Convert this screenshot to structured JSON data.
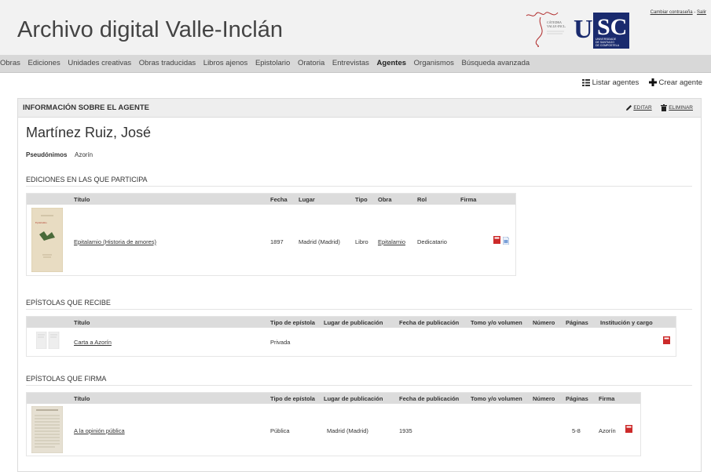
{
  "header": {
    "title": "Archivo digital Valle-Inclán",
    "logo_catedra_text": [
      "CÁTEDRA",
      "VALLE-INCLÁN"
    ],
    "logo_usc": {
      "letters": "USC",
      "lines": [
        "UNIVERSIDADE",
        "DE SANTIAGO",
        "DE COMPOSTELA"
      ]
    },
    "change_password": "Cambiar contraseña",
    "separator": "-",
    "logout": "Salir"
  },
  "nav": {
    "items": [
      "Obras",
      "Ediciones",
      "Unidades creativas",
      "Obras traducidas",
      "Libros ajenos",
      "Epistolario",
      "Oratoria",
      "Entrevistas",
      "Agentes",
      "Organismos",
      "Búsqueda avanzada"
    ],
    "active": "Agentes"
  },
  "actions": {
    "list": "Listar agentes",
    "create": "Crear agente"
  },
  "panel": {
    "title": "INFORMACIÓN SOBRE EL AGENTE",
    "edit": "EDITAR",
    "delete": "ELIMINAR"
  },
  "agent": {
    "name": "Martínez Ruiz, José",
    "pseudonyms_label": "Pseudónimos",
    "pseudonyms": "Azorín"
  },
  "editions": {
    "title": "EDICIONES EN LAS QUE PARTICIPA",
    "headers": [
      "Título",
      "Fecha",
      "Lugar",
      "Tipo",
      "Obra",
      "Rol",
      "Firma"
    ],
    "rows": [
      {
        "title": "Epitalamio (Historia de amores)",
        "date": "1897",
        "place": "Madrid (Madrid)",
        "type": "Libro",
        "work": "Epitalamio",
        "role": "Dedicatario",
        "signature": ""
      }
    ],
    "thumb_title": "Epitalamio"
  },
  "received": {
    "title": "EPÍSTOLAS QUE RECIBE",
    "headers": [
      "Título",
      "Tipo de epístola",
      "Lugar de publicación",
      "Fecha de publicación",
      "Tomo y/o volumen",
      "Número",
      "Páginas",
      "Institución y cargo"
    ],
    "rows": [
      {
        "title": "Carta a Azorín",
        "type": "Privada",
        "place": "",
        "date": "",
        "volume": "",
        "number": "",
        "pages": "",
        "institution": ""
      }
    ]
  },
  "signed": {
    "title": "EPÍSTOLAS QUE FIRMA",
    "headers": [
      "Título",
      "Tipo de epístola",
      "Lugar de publicación",
      "Fecha de publicación",
      "Tomo y/o volumen",
      "Número",
      "Páginas",
      "Firma"
    ],
    "rows": [
      {
        "title": "A la opinión pública",
        "type": "Pública",
        "place": "Madrid (Madrid)",
        "date": "1935",
        "volume": "",
        "number": "",
        "pages": "5-8",
        "signature": "Azorín"
      }
    ]
  },
  "icons": {
    "list": "list-icon",
    "create": "plus-icon",
    "edit": "pencil-icon",
    "delete": "trash-icon",
    "pdf": "pdf-icon",
    "document": "document-icon"
  },
  "colors": {
    "pdf_red": "#cc2a2a",
    "usc_blue": "#1a2b6e",
    "logo_red": "#b02a2a"
  }
}
